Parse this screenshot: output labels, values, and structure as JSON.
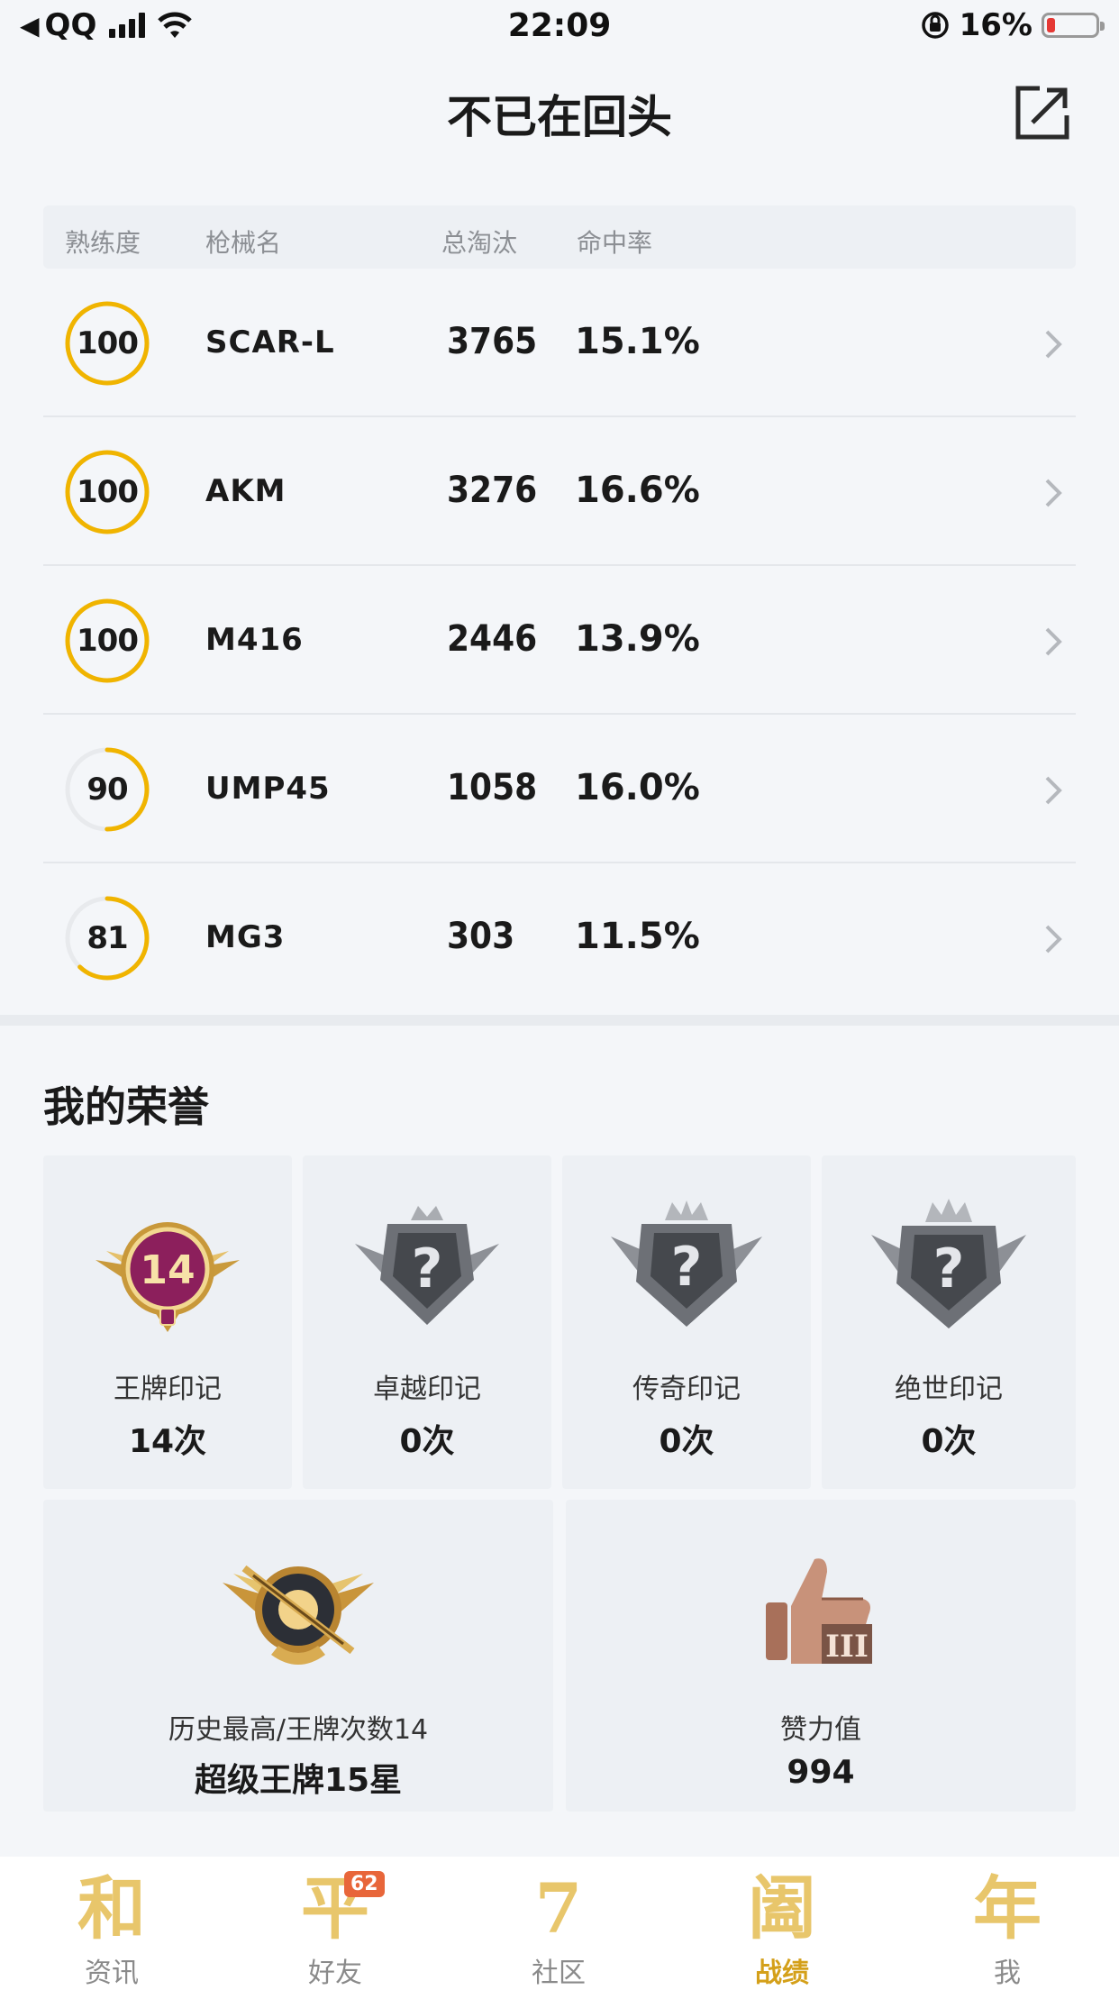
{
  "status_bar": {
    "back_app": "QQ",
    "time": "22:09",
    "battery": "16%"
  },
  "nav": {
    "title": "不已在回头"
  },
  "table": {
    "headers": [
      "熟练度",
      "枪械名",
      "总淘汰",
      "命中率"
    ],
    "rows": [
      {
        "proficiency": "100",
        "weapon": "SCAR-L",
        "kills": "3765",
        "accuracy": "15.1%",
        "progress": 1.0
      },
      {
        "proficiency": "100",
        "weapon": "AKM",
        "kills": "3276",
        "accuracy": "16.6%",
        "progress": 1.0
      },
      {
        "proficiency": "100",
        "weapon": "M416",
        "kills": "2446",
        "accuracy": "13.9%",
        "progress": 1.0
      },
      {
        "proficiency": "90",
        "weapon": "UMP45",
        "kills": "1058",
        "accuracy": "16.0%",
        "progress": 0.5
      },
      {
        "proficiency": "81",
        "weapon": "MG3",
        "kills": "303",
        "accuracy": "11.5%",
        "progress": 0.62
      }
    ]
  },
  "honors": {
    "title": "我的荣誉",
    "marks": [
      {
        "label": "王牌印记",
        "value": "14次",
        "badge_text": "14",
        "icon": "ace-badge-icon"
      },
      {
        "label": "卓越印记",
        "value": "0次",
        "badge_text": "?",
        "icon": "locked-badge-icon"
      },
      {
        "label": "传奇印记",
        "value": "0次",
        "badge_text": "?",
        "icon": "locked-badge-icon"
      },
      {
        "label": "绝世印记",
        "value": "0次",
        "badge_text": "?",
        "icon": "locked-badge-icon"
      }
    ],
    "history": {
      "label": "历史最高/王牌次数14",
      "value": "超级王牌15星",
      "icon": "rank-emblem-icon"
    },
    "likes": {
      "label": "赞力值",
      "value": "994",
      "icon": "thumbs-up-icon",
      "badge_text": "III"
    }
  },
  "tabbar": {
    "tabs": [
      {
        "label": "资讯",
        "glyph": "和",
        "active": false
      },
      {
        "label": "好友",
        "glyph": "平",
        "badge": "62",
        "active": false
      },
      {
        "label": "社区",
        "glyph": "7",
        "active": false
      },
      {
        "label": "战绩",
        "glyph": "阖",
        "active": true
      },
      {
        "label": "我",
        "glyph": "年",
        "active": false
      }
    ]
  },
  "colors": {
    "accent_gold": "#f0b400",
    "ring_track": "#e8eaed",
    "active_tab": "#d4a01a",
    "battery_low": "#e53935"
  }
}
